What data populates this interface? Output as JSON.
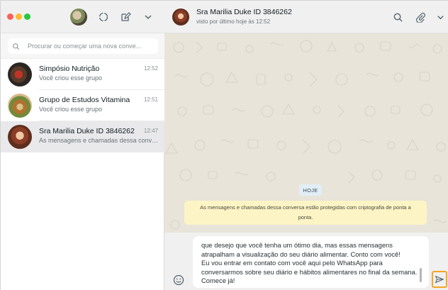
{
  "sidebar": {
    "search": {
      "placeholder": "Procurar ou começar uma nova conve..."
    },
    "chats": [
      {
        "name": "Simpósio Nutrição",
        "time": "12:52",
        "preview": "Você criou esse grupo",
        "selected": false
      },
      {
        "name": "Grupo de Estudos Vitamina",
        "time": "12:51",
        "preview": "Você criou esse grupo",
        "selected": false
      },
      {
        "name": "Sra Marilia Duke ID 3846262",
        "time": "12:47",
        "preview": "As mensagens e chamadas dessa conversa estão protegidas com criptografia de ponta a ponta.",
        "selected": true
      }
    ]
  },
  "conversation": {
    "name": "Sra Marilia Duke ID 3846262",
    "status": "visto por último hoje às 12:52",
    "date_chip": "HOJE",
    "encryption_notice": "As mensagens e chamadas dessa conversa estão protegidas com criptografia de ponta a ponta.",
    "draft_message": "que desejo que você tenha um ótimo dia, mas essas mensagens\natrapalham a visualização do seu diário alimentar. Conto com você!\nEu vou entrar em contato com você aqui pelo WhatsApp para\nconversarmos sobre seu diário e hábitos alimentares no final da semana.\nComece já!"
  },
  "colors": {
    "traffic_red": "#fe5f57",
    "traffic_yellow": "#febc2e",
    "traffic_green": "#28c840",
    "chat_background": "#e8e4da",
    "notice_background": "#fdf4c5",
    "send_highlight": "#f5a623"
  },
  "icons": {
    "search": "search-icon",
    "status": "status-icon",
    "new_chat": "new-chat-icon",
    "menu": "chevron-down-icon",
    "attach": "paperclip-icon",
    "emoji": "emoji-icon",
    "send": "send-icon"
  }
}
